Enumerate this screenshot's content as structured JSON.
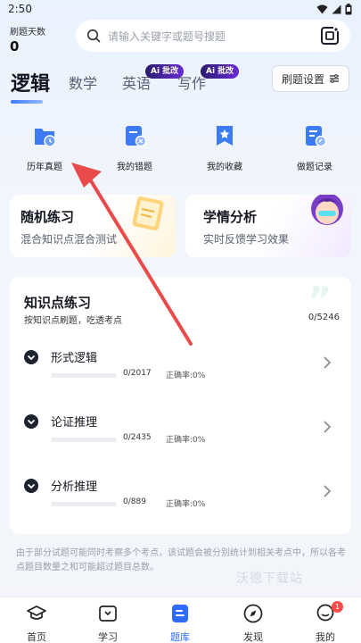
{
  "status_bar": {
    "time": "2:50"
  },
  "header": {
    "streak_label": "刷题天数",
    "streak_value": "0",
    "search_placeholder": "请输入关键字或题号搜题"
  },
  "tabs": [
    {
      "label": "逻辑",
      "active": true
    },
    {
      "label": "数学",
      "active": false
    },
    {
      "label": "英语",
      "badge": "Ai 批改"
    },
    {
      "label": "写作",
      "badge": "Ai 批改"
    }
  ],
  "settings_label": "刷题设置",
  "quick_entries": [
    {
      "label": "历年真题",
      "icon": "folder-clock-icon"
    },
    {
      "label": "我的错题",
      "icon": "wrong-answer-icon"
    },
    {
      "label": "我的收藏",
      "icon": "bookmark-star-icon"
    },
    {
      "label": "做题记录",
      "icon": "record-icon"
    }
  ],
  "cards": {
    "random": {
      "title": "随机练习",
      "subtitle": "混合知识点混合测试"
    },
    "analysis": {
      "title": "学情分析",
      "subtitle": "实时反馈学习效果"
    }
  },
  "knowledge": {
    "title": "知识点练习",
    "subtitle": "按知识点刷题，吃透考点",
    "total": "0/5246",
    "rows": [
      {
        "name": "形式逻辑",
        "count": "0/2017",
        "accuracy": "正确率:0%",
        "progress": 0
      },
      {
        "name": "论证推理",
        "count": "0/2435",
        "accuracy": "正确率:0%",
        "progress": 0
      },
      {
        "name": "分析推理",
        "count": "0/889",
        "accuracy": "正确率:0%",
        "progress": 0
      }
    ]
  },
  "footnote": "由于部分试题可能同时考察多个考点，该试题会被分别统计到相关考点中，所以各考点题目数量之和可能超过题目总数。",
  "watermark": "沃德下载站",
  "bottom_nav": [
    {
      "label": "首页",
      "icon": "graduation-cap-icon"
    },
    {
      "label": "学习",
      "icon": "book-icon"
    },
    {
      "label": "题库",
      "icon": "question-bank-icon",
      "active": true
    },
    {
      "label": "发现",
      "icon": "compass-icon"
    },
    {
      "label": "我的",
      "icon": "profile-icon",
      "badge": "1"
    }
  ],
  "colors": {
    "accent": "#2f6bff",
    "annotation_arrow": "#e94a4a"
  }
}
